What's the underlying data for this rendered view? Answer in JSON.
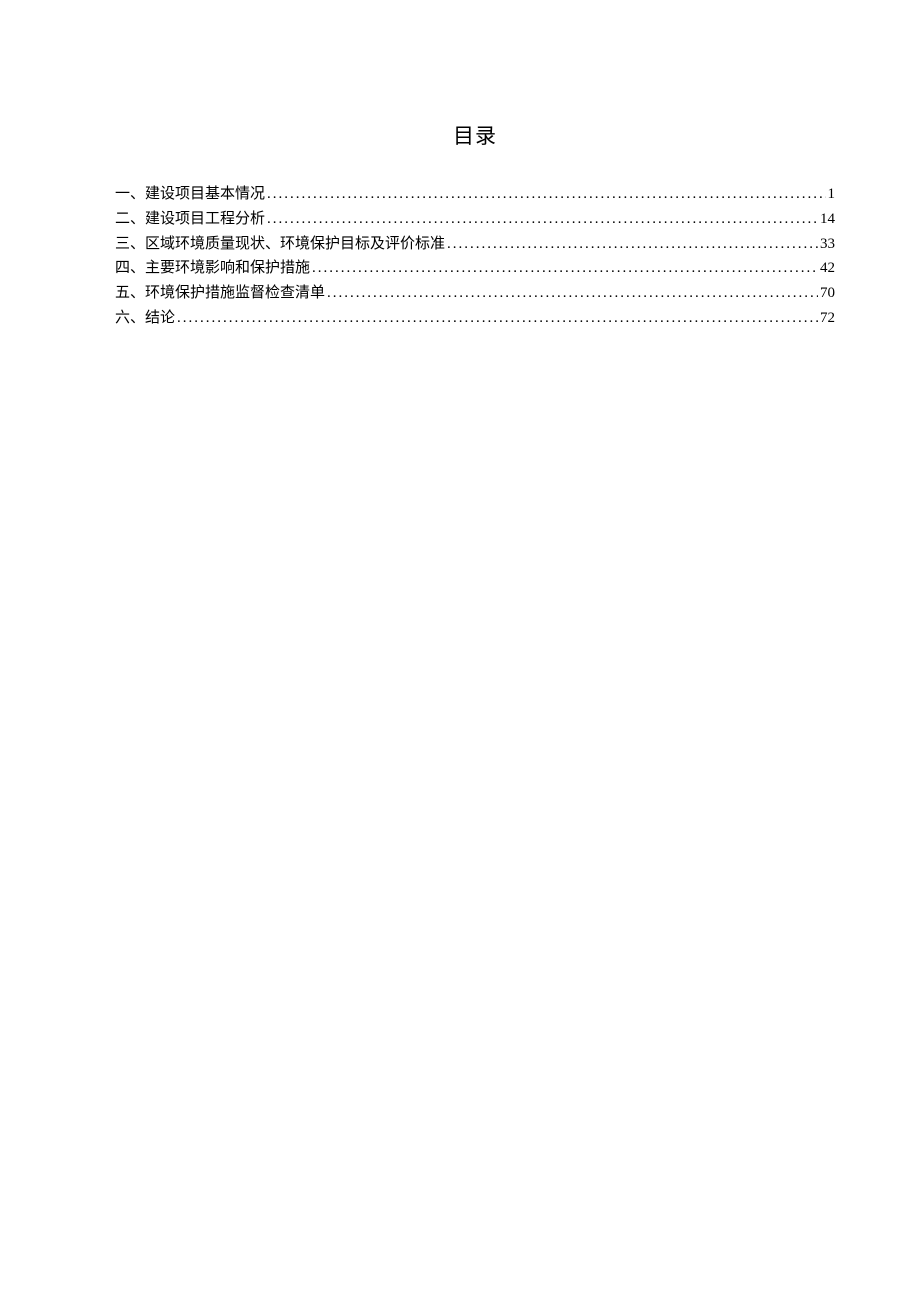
{
  "title": "目录",
  "toc": [
    {
      "label": "一、建设项目基本情况",
      "page": "1"
    },
    {
      "label": "二、建设项目工程分析",
      "page": "14"
    },
    {
      "label": "三、区域环境质量现状、环境保护目标及评价标准",
      "page": "33"
    },
    {
      "label": "四、主要环境影响和保护措施",
      "page": "42"
    },
    {
      "label": "五、环境保护措施监督检查清单",
      "page": "70"
    },
    {
      "label": "六、结论",
      "page": "72"
    }
  ]
}
